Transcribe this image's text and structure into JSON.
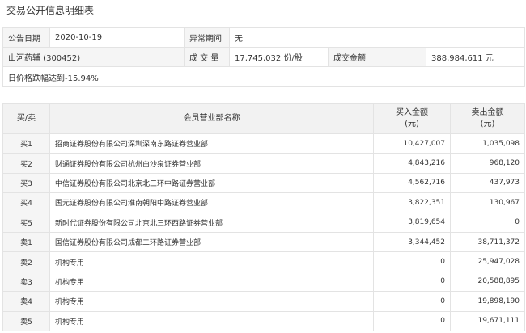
{
  "title": "交易公开信息明细表",
  "info": {
    "date_label": "公告日期",
    "date_value": "2020-10-19",
    "period_label": "异常期间",
    "period_value": "无",
    "stock": "山河药辅 (300452)",
    "volume_label": "成 交 量",
    "volume_value": "17,745,032 份/股",
    "amount_label": "成交金额",
    "amount_value": "388,984,611 元",
    "reason": "日价格跌幅达到-15.94%"
  },
  "table": {
    "headers": {
      "side": "买/卖",
      "name": "会员营业部名称",
      "buy": "买入金额",
      "buy_unit": "(元)",
      "sell": "卖出金额",
      "sell_unit": "(元)"
    },
    "rows": [
      {
        "side": "买1",
        "name": "招商证券股份有限公司深圳深南东路证券营业部",
        "buy": "10,427,007",
        "sell": "1,035,098"
      },
      {
        "side": "买2",
        "name": "财通证券股份有限公司杭州白沙泉证券营业部",
        "buy": "4,843,216",
        "sell": "968,120"
      },
      {
        "side": "买3",
        "name": "中信证券股份有限公司北京北三环中路证券营业部",
        "buy": "4,562,716",
        "sell": "437,973"
      },
      {
        "side": "买4",
        "name": "国元证券股份有限公司淮南朝阳中路证券营业部",
        "buy": "3,822,351",
        "sell": "130,967"
      },
      {
        "side": "买5",
        "name": "新时代证券股份有限公司北京北三环西路证券营业部",
        "buy": "3,819,654",
        "sell": "0"
      },
      {
        "side": "卖1",
        "name": "国信证券股份有限公司成都二环路证券营业部",
        "buy": "3,344,452",
        "sell": "38,711,372"
      },
      {
        "side": "卖2",
        "name": "机构专用",
        "buy": "0",
        "sell": "25,947,028"
      },
      {
        "side": "卖3",
        "name": "机构专用",
        "buy": "0",
        "sell": "20,588,895"
      },
      {
        "side": "卖4",
        "name": "机构专用",
        "buy": "0",
        "sell": "19,898,190"
      },
      {
        "side": "卖5",
        "name": "机构专用",
        "buy": "0",
        "sell": "19,671,111"
      }
    ]
  }
}
